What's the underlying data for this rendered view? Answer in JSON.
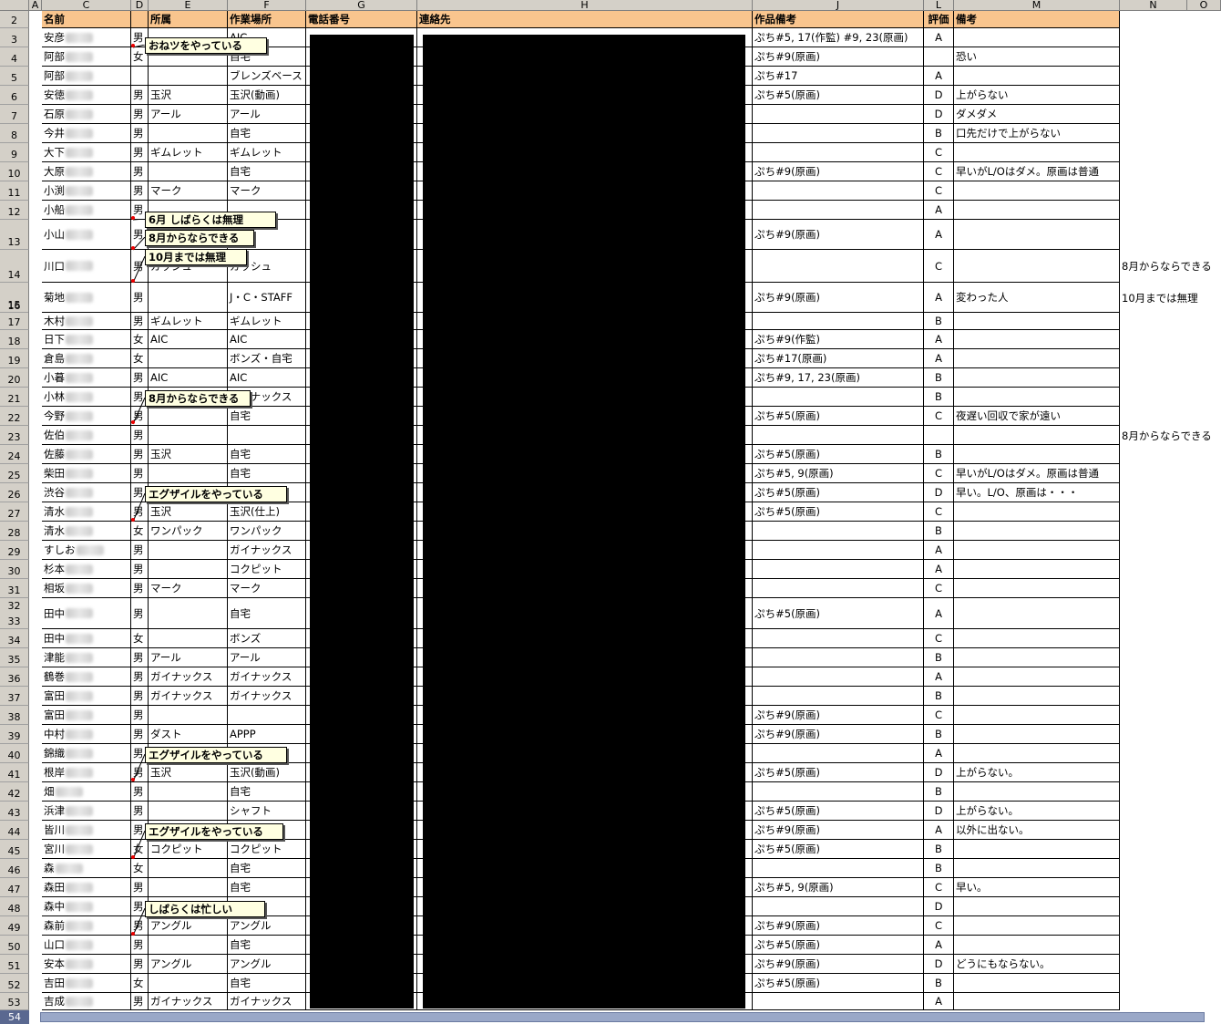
{
  "columns": [
    "A",
    "C",
    "D",
    "E",
    "F",
    "G",
    "H",
    "J",
    "L",
    "M",
    "N",
    "O"
  ],
  "header_row": {
    "row": "2",
    "name": "名前",
    "affiliation": "所属",
    "workplace": "作業場所",
    "phone": "電話番号",
    "contact": "連絡先",
    "works_note": "作品備考",
    "rating": "評価",
    "remarks": "備考"
  },
  "rows": [
    {
      "row": "3",
      "name": "安彦",
      "gender": "男",
      "affiliation": "",
      "workplace": "AIC",
      "works": "ぷち#5, 17(作監) #9, 23(原画)",
      "rating": "A",
      "remarks": ""
    },
    {
      "row": "4",
      "name": "阿部",
      "gender": "女",
      "affiliation": "",
      "workplace": "自宅",
      "works": "ぷち#9(原画)",
      "rating": "",
      "remarks": "恐い"
    },
    {
      "row": "5",
      "name": "阿部",
      "gender": "",
      "affiliation": "",
      "workplace": "ブレンズベース",
      "works": "ぷち#17",
      "rating": "A",
      "remarks": ""
    },
    {
      "row": "6",
      "name": "安徳",
      "gender": "男",
      "affiliation": "玉沢",
      "workplace": "玉沢(動画)",
      "works": "ぷち#5(原画)",
      "rating": "D",
      "remarks": "上がらない"
    },
    {
      "row": "7",
      "name": "石原",
      "gender": "男",
      "affiliation": "アール",
      "workplace": "アール",
      "works": "",
      "rating": "D",
      "remarks": "ダメダメ"
    },
    {
      "row": "8",
      "name": "今井",
      "gender": "男",
      "affiliation": "",
      "workplace": "自宅",
      "works": "",
      "rating": "B",
      "remarks": "口先だけで上がらない"
    },
    {
      "row": "9",
      "name": "大下",
      "gender": "男",
      "affiliation": "ギムレット",
      "workplace": "ギムレット",
      "works": "",
      "rating": "C",
      "remarks": ""
    },
    {
      "row": "10",
      "name": "大原",
      "gender": "男",
      "affiliation": "",
      "workplace": "自宅",
      "works": "ぷち#9(原画)",
      "rating": "C",
      "remarks": "早いがL/Oはダメ。原画は普通"
    },
    {
      "row": "11",
      "name": "小渕",
      "gender": "男",
      "affiliation": "マーク",
      "workplace": "マーク",
      "works": "",
      "rating": "C",
      "remarks": ""
    },
    {
      "row": "12",
      "name": "小船",
      "gender": "男",
      "affiliation": "",
      "workplace": "",
      "works": "",
      "rating": "A",
      "remarks": ""
    },
    {
      "row": "13",
      "name": "小山",
      "gender": "男",
      "affiliation": "",
      "workplace": "",
      "works": "ぷち#9(原画)",
      "rating": "A",
      "remarks": ""
    },
    {
      "row": "14",
      "name": "川口",
      "gender": "男",
      "affiliation": "ガッシュ",
      "workplace": "ガッシュ",
      "works": "",
      "rating": "C",
      "remarks": "",
      "ext": "8月からならできる"
    },
    {
      "row": "15",
      "name": "菊地",
      "gender": "男",
      "affiliation": "",
      "workplace": "J・C・STAFF",
      "works": "ぷち#9(原画)",
      "rating": "A",
      "remarks": "変わった人",
      "ext": "10月までは無理"
    },
    {
      "row": "17",
      "name": "木村",
      "gender": "男",
      "affiliation": "ギムレット",
      "workplace": "ギムレット",
      "works": "",
      "rating": "B",
      "remarks": ""
    },
    {
      "row": "18",
      "name": "日下",
      "gender": "女",
      "affiliation": "AIC",
      "workplace": "AIC",
      "works": "ぷち#9(作監)",
      "rating": "A",
      "remarks": ""
    },
    {
      "row": "19",
      "name": "倉島",
      "gender": "女",
      "affiliation": "",
      "workplace": "ボンズ・自宅",
      "works": "ぷち#17(原画)",
      "rating": "A",
      "remarks": ""
    },
    {
      "row": "20",
      "name": "小暮",
      "gender": "男",
      "affiliation": "AIC",
      "workplace": "AIC",
      "works": "ぷち#9, 17, 23(原画)",
      "rating": "B",
      "remarks": ""
    },
    {
      "row": "21",
      "name": "小林",
      "gender": "男",
      "affiliation": "",
      "workplace": "ガイナックス",
      "works": "",
      "rating": "B",
      "remarks": ""
    },
    {
      "row": "22",
      "name": "今野",
      "gender": "男",
      "affiliation": "",
      "workplace": "自宅",
      "works": "ぷち#5(原画)",
      "rating": "C",
      "remarks": "夜遅い回収で家が遠い"
    },
    {
      "row": "23",
      "name": "佐伯",
      "gender": "男",
      "affiliation": "",
      "workplace": "",
      "works": "",
      "rating": "",
      "remarks": "",
      "ext": "8月からならできる"
    },
    {
      "row": "24",
      "name": "佐藤",
      "gender": "男",
      "affiliation": "玉沢",
      "workplace": "自宅",
      "works": "ぷち#5(原画)",
      "rating": "B",
      "remarks": ""
    },
    {
      "row": "25",
      "name": "柴田",
      "gender": "男",
      "affiliation": "",
      "workplace": "自宅",
      "works": "ぷち#5, 9(原画)",
      "rating": "C",
      "remarks": "早いがL/Oはダメ。原画は普通"
    },
    {
      "row": "26",
      "name": "渋谷",
      "gender": "男",
      "affiliation": "",
      "workplace": "",
      "works": "ぷち#5(原画)",
      "rating": "D",
      "remarks": "早い。L/O、原画は・・・"
    },
    {
      "row": "27",
      "name": "清水",
      "gender": "男",
      "affiliation": "玉沢",
      "workplace": "玉沢(仕上)",
      "works": "ぷち#5(原画)",
      "rating": "C",
      "remarks": ""
    },
    {
      "row": "28",
      "name": "清水",
      "gender": "女",
      "affiliation": "ワンパック",
      "workplace": "ワンパック",
      "works": "",
      "rating": "B",
      "remarks": ""
    },
    {
      "row": "29",
      "name": "すしお",
      "gender": "男",
      "affiliation": "",
      "workplace": "ガイナックス",
      "works": "",
      "rating": "A",
      "remarks": ""
    },
    {
      "row": "30",
      "name": "杉本",
      "gender": "男",
      "affiliation": "",
      "workplace": "コクピット",
      "works": "",
      "rating": "A",
      "remarks": ""
    },
    {
      "row": "31",
      "name": "相坂",
      "gender": "男",
      "affiliation": "マーク",
      "workplace": "マーク",
      "works": "",
      "rating": "C",
      "remarks": ""
    },
    {
      "row": "33",
      "name": "田中",
      "gender": "男",
      "affiliation": "",
      "workplace": "自宅",
      "works": "ぷち#5(原画)",
      "rating": "A",
      "remarks": ""
    },
    {
      "row": "34",
      "name": "田中",
      "gender": "女",
      "affiliation": "",
      "workplace": "ボンズ",
      "works": "",
      "rating": "C",
      "remarks": ""
    },
    {
      "row": "35",
      "name": "津能",
      "gender": "男",
      "affiliation": "アール",
      "workplace": "アール",
      "works": "",
      "rating": "B",
      "remarks": ""
    },
    {
      "row": "36",
      "name": "鶴巻",
      "gender": "男",
      "affiliation": "ガイナックス",
      "workplace": "ガイナックス",
      "works": "",
      "rating": "A",
      "remarks": ""
    },
    {
      "row": "37",
      "name": "富田",
      "gender": "男",
      "affiliation": "ガイナックス",
      "workplace": "ガイナックス",
      "works": "",
      "rating": "B",
      "remarks": ""
    },
    {
      "row": "38",
      "name": "富田",
      "gender": "男",
      "affiliation": "",
      "workplace": "",
      "works": "ぷち#9(原画)",
      "rating": "C",
      "remarks": ""
    },
    {
      "row": "39",
      "name": "中村",
      "gender": "男",
      "affiliation": "ダスト",
      "workplace": "APPP",
      "works": "ぷち#9(原画)",
      "rating": "B",
      "remarks": ""
    },
    {
      "row": "40",
      "name": "錦織",
      "gender": "男",
      "affiliation": "",
      "workplace": "",
      "works": "",
      "rating": "A",
      "remarks": ""
    },
    {
      "row": "41",
      "name": "根岸",
      "gender": "男",
      "affiliation": "玉沢",
      "workplace": "玉沢(動画)",
      "works": "ぷち#5(原画)",
      "rating": "D",
      "remarks": "上がらない。"
    },
    {
      "row": "42",
      "name": "畑",
      "gender": "男",
      "affiliation": "",
      "workplace": "自宅",
      "works": "",
      "rating": "B",
      "remarks": ""
    },
    {
      "row": "43",
      "name": "浜津",
      "gender": "男",
      "affiliation": "",
      "workplace": "シャフト",
      "works": "ぷち#5(原画)",
      "rating": "D",
      "remarks": "上がらない。"
    },
    {
      "row": "44",
      "name": "皆川",
      "gender": "男",
      "affiliation": "",
      "workplace": "",
      "works": "ぷち#9(原画)",
      "rating": "A",
      "remarks": "以外に出ない。"
    },
    {
      "row": "45",
      "name": "宮川",
      "gender": "女",
      "affiliation": "コクピット",
      "workplace": "コクピット",
      "works": "ぷち#5(原画)",
      "rating": "B",
      "remarks": ""
    },
    {
      "row": "46",
      "name": "森",
      "gender": "女",
      "affiliation": "",
      "workplace": "自宅",
      "works": "",
      "rating": "B",
      "remarks": ""
    },
    {
      "row": "47",
      "name": "森田",
      "gender": "男",
      "affiliation": "",
      "workplace": "自宅",
      "works": "ぷち#5, 9(原画)",
      "rating": "C",
      "remarks": "早い。"
    },
    {
      "row": "48",
      "name": "森中",
      "gender": "男",
      "affiliation": "",
      "workplace": "",
      "works": "",
      "rating": "D",
      "remarks": ""
    },
    {
      "row": "49",
      "name": "森前",
      "gender": "男",
      "affiliation": "アングル",
      "workplace": "アングル",
      "works": "ぷち#9(原画)",
      "rating": "C",
      "remarks": ""
    },
    {
      "row": "50",
      "name": "山口",
      "gender": "男",
      "affiliation": "",
      "workplace": "自宅",
      "works": "ぷち#5(原画)",
      "rating": "A",
      "remarks": ""
    },
    {
      "row": "51",
      "name": "安本",
      "gender": "男",
      "affiliation": "アングル",
      "workplace": "アングル",
      "works": "ぷち#9(原画)",
      "rating": "D",
      "remarks": "どうにもならない。"
    },
    {
      "row": "52",
      "name": "吉田",
      "gender": "女",
      "affiliation": "",
      "workplace": "自宅",
      "works": "ぷち#5(原画)",
      "rating": "B",
      "remarks": ""
    },
    {
      "row": "53",
      "name": "吉成",
      "gender": "男",
      "affiliation": "ガイナックス",
      "workplace": "ガイナックス",
      "works": "",
      "rating": "A",
      "remarks": ""
    }
  ],
  "extra_row_labels": {
    "r16": "16",
    "r32": "32",
    "r54": "54"
  },
  "comments": [
    {
      "text": "おねツをやっている"
    },
    {
      "text": "6月 しばらくは無理"
    },
    {
      "text": "8月からならできる"
    },
    {
      "text": "10月までは無理"
    },
    {
      "text": "8月からならできる"
    },
    {
      "text": "エグザイルをやっている"
    },
    {
      "text": "エグザイルをやっている"
    },
    {
      "text": "エグザイルをやっている"
    },
    {
      "text": "しばらくは忙しい"
    }
  ],
  "colors": {
    "header_fill": "#f9c58e",
    "comment_fill": "#ffffe1",
    "redaction": "#000000",
    "chrome": "#d4d0c8"
  }
}
